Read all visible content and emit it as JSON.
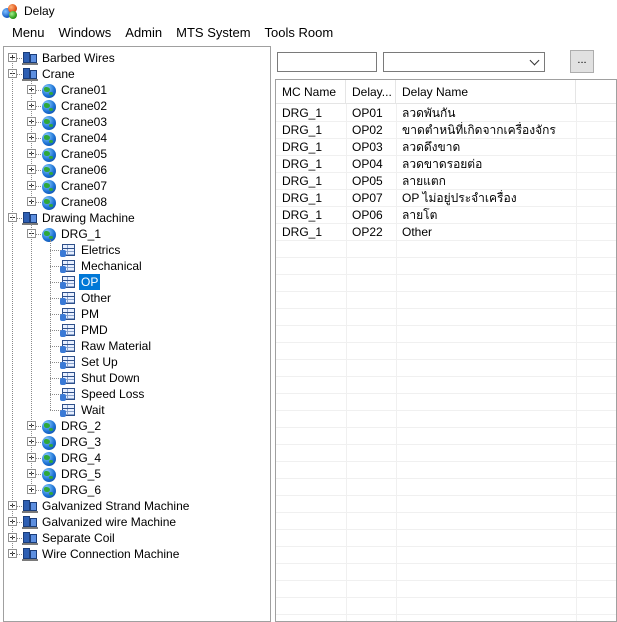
{
  "window": {
    "title": "Delay"
  },
  "menu": [
    "Menu",
    "Windows",
    "Admin",
    "MTS System",
    "Tools Room"
  ],
  "tree": [
    {
      "label": "Barbed Wires",
      "icon": "server",
      "level": 0,
      "expander": "plus"
    },
    {
      "label": "Crane",
      "icon": "server",
      "level": 0,
      "expander": "minus"
    },
    {
      "label": "Crane01",
      "icon": "globe",
      "level": 1,
      "expander": "plus"
    },
    {
      "label": "Crane02",
      "icon": "globe",
      "level": 1,
      "expander": "plus"
    },
    {
      "label": "Crane03",
      "icon": "globe",
      "level": 1,
      "expander": "plus"
    },
    {
      "label": "Crane04",
      "icon": "globe",
      "level": 1,
      "expander": "plus"
    },
    {
      "label": "Crane05",
      "icon": "globe",
      "level": 1,
      "expander": "plus"
    },
    {
      "label": "Crane06",
      "icon": "globe",
      "level": 1,
      "expander": "plus"
    },
    {
      "label": "Crane07",
      "icon": "globe",
      "level": 1,
      "expander": "plus"
    },
    {
      "label": "Crane08",
      "icon": "globe",
      "level": 1,
      "expander": "plus"
    },
    {
      "label": "Drawing Machine",
      "icon": "server",
      "level": 0,
      "expander": "minus"
    },
    {
      "label": "DRG_1",
      "icon": "globe",
      "level": 1,
      "expander": "minus"
    },
    {
      "label": "Eletrics",
      "icon": "grid",
      "level": 2,
      "expander": "none"
    },
    {
      "label": "Mechanical",
      "icon": "grid",
      "level": 2,
      "expander": "none"
    },
    {
      "label": "OP",
      "icon": "grid",
      "level": 2,
      "expander": "none",
      "selected": true
    },
    {
      "label": "Other",
      "icon": "grid",
      "level": 2,
      "expander": "none"
    },
    {
      "label": "PM",
      "icon": "grid",
      "level": 2,
      "expander": "none"
    },
    {
      "label": "PMD",
      "icon": "grid",
      "level": 2,
      "expander": "none"
    },
    {
      "label": "Raw Material",
      "icon": "grid",
      "level": 2,
      "expander": "none"
    },
    {
      "label": "Set Up",
      "icon": "grid",
      "level": 2,
      "expander": "none"
    },
    {
      "label": "Shut Down",
      "icon": "grid",
      "level": 2,
      "expander": "none"
    },
    {
      "label": "Speed Loss",
      "icon": "grid",
      "level": 2,
      "expander": "none"
    },
    {
      "label": "Wait",
      "icon": "grid",
      "level": 2,
      "expander": "none"
    },
    {
      "label": "DRG_2",
      "icon": "globe",
      "level": 1,
      "expander": "plus"
    },
    {
      "label": "DRG_3",
      "icon": "globe",
      "level": 1,
      "expander": "plus"
    },
    {
      "label": "DRG_4",
      "icon": "globe",
      "level": 1,
      "expander": "plus"
    },
    {
      "label": "DRG_5",
      "icon": "globe",
      "level": 1,
      "expander": "plus"
    },
    {
      "label": "DRG_6",
      "icon": "globe",
      "level": 1,
      "expander": "plus"
    },
    {
      "label": "Galvanized Strand Machine",
      "icon": "server",
      "level": 0,
      "expander": "plus"
    },
    {
      "label": "Galvanized wire Machine",
      "icon": "server",
      "level": 0,
      "expander": "plus"
    },
    {
      "label": "Separate Coil",
      "icon": "server",
      "level": 0,
      "expander": "plus"
    },
    {
      "label": "Wire Connection Machine",
      "icon": "server",
      "level": 0,
      "expander": "plus"
    }
  ],
  "filter": {
    "input_value": "",
    "select_value": "",
    "button_label": "..."
  },
  "table": {
    "headers": [
      "MC Name",
      "Delay...",
      "Delay Name"
    ],
    "rows": [
      [
        "DRG_1",
        "OP01",
        "ลวดพันกัน"
      ],
      [
        "DRG_1",
        "OP02",
        "ขาดตำหนิที่เกิดจากเครื่องจักร"
      ],
      [
        "DRG_1",
        "OP03",
        "ลวดดึงขาด"
      ],
      [
        "DRG_1",
        "OP04",
        "ลวดขาดรอยต่อ"
      ],
      [
        "DRG_1",
        "OP05",
        "ลายแตก"
      ],
      [
        "DRG_1",
        "OP07",
        "OP ไม่อยู่ประจำเครื่อง"
      ],
      [
        "DRG_1",
        "OP06",
        "ลายโต"
      ],
      [
        "DRG_1",
        "OP22",
        "Other"
      ]
    ]
  },
  "colors": {
    "selection": "#0078d7",
    "border": "#a0a0a0"
  }
}
